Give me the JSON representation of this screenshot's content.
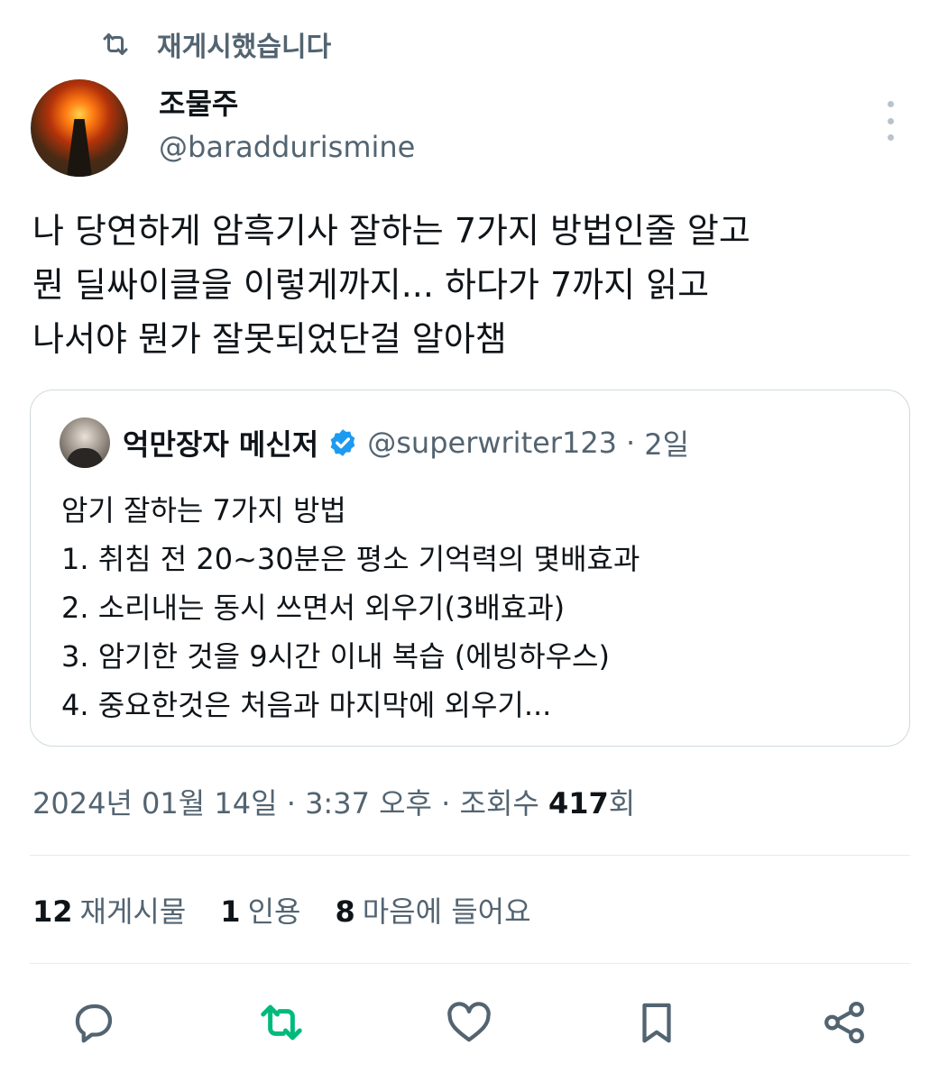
{
  "repost_banner": {
    "icon": "repost-icon",
    "label": "재게시했습니다"
  },
  "author": {
    "display_name": "조물주",
    "handle": "@baraddurismine"
  },
  "post": {
    "text": "나 당연하게 암흑기사 잘하는 7가지 방법인줄 알고\n뭔 딜싸이클을 이렇게까지... 하다가 7까지 읽고\n나서야 뭔가 잘못되었단걸 알아챔"
  },
  "quote": {
    "display_name": "억만장자 메신저",
    "handle": "@superwriter123",
    "separator": "·",
    "time": "2일",
    "lines": [
      "암기 잘하는 7가지 방법",
      "1. 취침 전 20~30분은 평소 기억력의 몇배효과",
      "2. 소리내는 동시 쓰면서 외우기(3배효과)",
      "3. 암기한 것을 9시간 이내 복습 (에빙하우스)",
      "4. 중요한것은 처음과 마지막에 외우기..."
    ]
  },
  "meta": {
    "date": "2024년 01월 14일",
    "separator": "·",
    "time": "3:37 오후",
    "views_label": "조회수",
    "views_count": "417",
    "views_suffix": "회"
  },
  "stats": {
    "reposts_count": "12",
    "reposts_label": "재게시물",
    "quotes_count": "1",
    "quotes_label": "인용",
    "likes_count": "8",
    "likes_label": "마음에 들어요"
  },
  "colors": {
    "text": "#0f1419",
    "secondary": "#536471",
    "repost_green": "#00ba7c",
    "verified_blue": "#1d9bf0",
    "border": "#cfd9de"
  },
  "action_icons": [
    "reply-icon",
    "repost-icon",
    "like-icon",
    "bookmark-icon",
    "share-icon"
  ]
}
